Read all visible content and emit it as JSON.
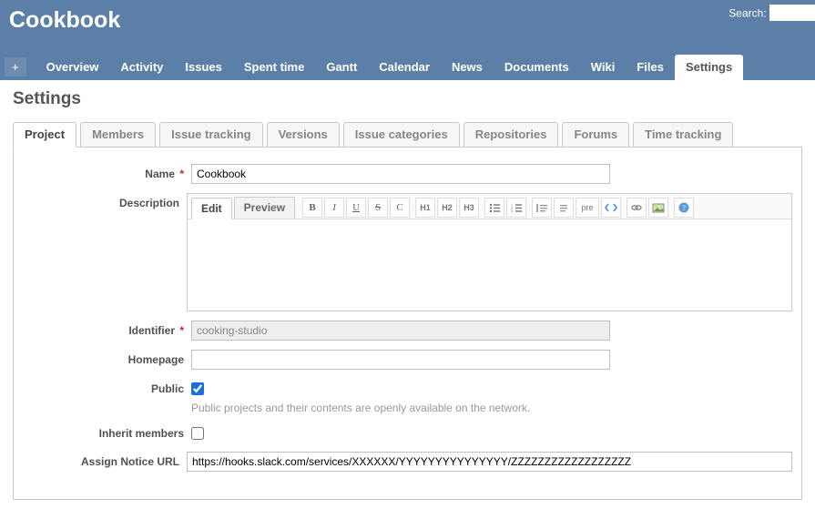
{
  "header": {
    "project_title": "Cookbook",
    "search_label": "Search:"
  },
  "main_menu": {
    "plus": "+",
    "items": [
      "Overview",
      "Activity",
      "Issues",
      "Spent time",
      "Gantt",
      "Calendar",
      "News",
      "Documents",
      "Wiki",
      "Files",
      "Settings"
    ],
    "selected": "Settings"
  },
  "page_title": "Settings",
  "settings_tabs": {
    "items": [
      "Project",
      "Members",
      "Issue tracking",
      "Versions",
      "Issue categories",
      "Repositories",
      "Forums",
      "Time tracking"
    ],
    "active": "Project"
  },
  "form": {
    "name": {
      "label": "Name",
      "required": true,
      "value": "Cookbook"
    },
    "description": {
      "label": "Description",
      "edit_tab": "Edit",
      "preview_tab": "Preview",
      "toolbar": {
        "bold": "B",
        "italic": "I",
        "underline": "U",
        "strike": "S",
        "code": "C",
        "h1": "H1",
        "h2": "H2",
        "h3": "H3",
        "pre": "pre"
      }
    },
    "identifier": {
      "label": "Identifier",
      "required": true,
      "value": "cooking-studio"
    },
    "homepage": {
      "label": "Homepage",
      "value": ""
    },
    "public": {
      "label": "Public",
      "checked": true,
      "hint": "Public projects and their contents are openly available on the network."
    },
    "inherit": {
      "label": "Inherit members",
      "checked": false
    },
    "assign_url": {
      "label": "Assign Notice URL",
      "value": "https://hooks.slack.com/services/XXXXXX/YYYYYYYYYYYYYYY/ZZZZZZZZZZZZZZZZZZ"
    }
  }
}
